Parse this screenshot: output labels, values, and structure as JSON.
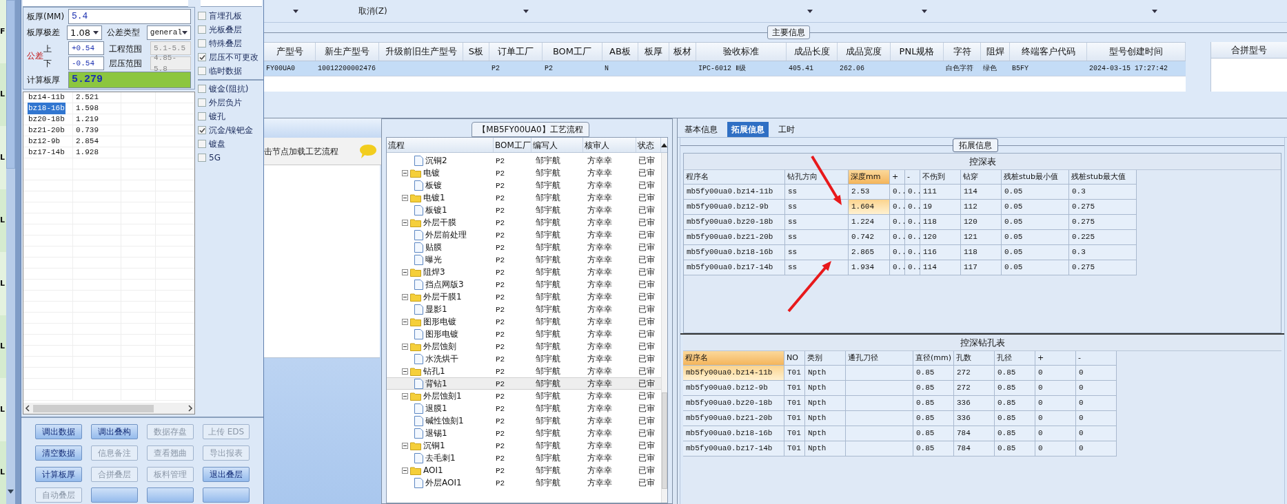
{
  "background_column": [
    "F",
    "L",
    "L",
    "L",
    "L",
    "L",
    "L",
    "L"
  ],
  "board_form": {
    "thickness_label": "板厚(MM)",
    "thickness": "5.4",
    "range_label": "板厚极差",
    "range": "1.08",
    "tol_type_label": "公差类型",
    "tol_type": "general",
    "tol_label": "公差",
    "upper_label": "上",
    "lower_label": "下",
    "upper": "+0.54",
    "lower": "-0.54",
    "eng_range_label": "工程范围",
    "eng_range": "5.1-5.5",
    "lam_range_label": "层压范围",
    "lam_range": "4.85-5.8",
    "calc_label": "计算板厚",
    "calc": "5.279"
  },
  "layer_list": [
    {
      "name": "bz14-11b",
      "value": "2.521",
      "selected": false
    },
    {
      "name": "bz18-16b",
      "value": "1.598",
      "selected": true
    },
    {
      "name": "bz20-18b",
      "value": "1.219",
      "selected": false
    },
    {
      "name": "bz21-20b",
      "value": "0.739",
      "selected": false
    },
    {
      "name": "bz12-9b",
      "value": "2.854",
      "selected": false
    },
    {
      "name": "bz17-14b",
      "value": "1.928",
      "selected": false
    }
  ],
  "option_groups": [
    [
      {
        "label": "盲埋孔板",
        "checked": false
      },
      {
        "label": "光板叠层",
        "checked": false
      },
      {
        "label": "特殊叠层",
        "checked": false
      },
      {
        "label": "层压不可更改",
        "checked": true
      },
      {
        "label": "临时数据",
        "checked": false
      }
    ],
    [
      {
        "label": "镀金(阻抗)",
        "checked": false
      },
      {
        "label": "外层负片",
        "checked": false
      },
      {
        "label": "镀孔",
        "checked": false
      },
      {
        "label": "沉金/镍钯金",
        "checked": true
      },
      {
        "label": "镀盘",
        "checked": false
      },
      {
        "label": "5G",
        "checked": false
      }
    ]
  ],
  "buttons": [
    {
      "label": "调出数据",
      "disabled": false
    },
    {
      "label": "调出叠构",
      "disabled": false
    },
    {
      "label": "数据存盘",
      "disabled": true
    },
    {
      "label": "上传 EDS",
      "disabled": true
    },
    {
      "label": "清空数据",
      "disabled": false
    },
    {
      "label": "信息备注",
      "disabled": true
    },
    {
      "label": "查看翘曲",
      "disabled": true
    },
    {
      "label": "导出报表",
      "disabled": true
    },
    {
      "label": "计算板厚",
      "disabled": false
    },
    {
      "label": "合拼叠层",
      "disabled": true
    },
    {
      "label": "板料管理",
      "disabled": true
    },
    {
      "label": "退出叠层",
      "disabled": false
    },
    {
      "label": "自动叠层",
      "disabled": true
    },
    {
      "disabled": false
    },
    {
      "disabled": false
    },
    {
      "disabled": false
    }
  ],
  "menu": {
    "cancel": "取消(Z)"
  },
  "main_info": {
    "title": "主要信息",
    "columns": [
      "产型号",
      "新生产型号",
      "升级前旧生产型号",
      "S板",
      "订单工厂",
      "BOM工厂",
      "AB板",
      "板厚",
      "板材",
      "验收标准",
      "成品长度",
      "成品宽度",
      "PNL规格",
      "字符",
      "阻焊",
      "终端客户代码",
      "型号创建时间"
    ],
    "rows": [
      {
        "selected": true,
        "cells": [
          "FY00UA0",
          "10012200002476",
          null,
          null,
          "P2",
          "P2",
          "N",
          null,
          null,
          "IPC-6012 Ⅱ级",
          "405.41",
          "262.06",
          null,
          "白色字符",
          "绿色",
          "B5FY",
          "2024-03-15 17:27:42"
        ]
      }
    ],
    "merge_column": "合拼型号"
  },
  "loader_hint": "击节点加载工艺流程",
  "process": {
    "title": "【MB5FY00UA0】工艺流程",
    "columns": [
      "流程",
      "BOM工厂",
      "编写人",
      "核审人",
      "状态"
    ],
    "tree": [
      {
        "children": [
          {
            "label": "沉铜2",
            "bom": "P2",
            "writer": "邹宇航",
            "reviewer": "方幸幸",
            "status": "已审",
            "selected": false
          }
        ]
      },
      {
        "label": "电镀",
        "bom": "P2",
        "writer": "邹宇航",
        "reviewer": "方幸幸",
        "status": "已审",
        "selected": false,
        "expanded": true,
        "children": [
          {
            "label": "板镀",
            "bom": "P2",
            "writer": "邹宇航",
            "reviewer": "方幸幸",
            "status": "已审",
            "selected": false
          }
        ]
      },
      {
        "label": "电镀1",
        "bom": "P2",
        "writer": "邹宇航",
        "reviewer": "方幸幸",
        "status": "已审",
        "selected": false,
        "expanded": true,
        "children": [
          {
            "label": "板镀1",
            "bom": "P2",
            "writer": "邹宇航",
            "reviewer": "方幸幸",
            "status": "已审",
            "selected": false
          }
        ]
      },
      {
        "label": "外层干膜",
        "bom": "P2",
        "writer": "邹宇航",
        "reviewer": "方幸幸",
        "status": "已审",
        "selected": false,
        "expanded": true,
        "children": [
          {
            "label": "外层前处理",
            "bom": "P2",
            "writer": "邹宇航",
            "reviewer": "方幸幸",
            "status": "已审",
            "selected": false
          },
          {
            "label": "贴膜",
            "bom": "P2",
            "writer": "邹宇航",
            "reviewer": "方幸幸",
            "status": "已审",
            "selected": false
          },
          {
            "label": "曝光",
            "bom": "P2",
            "writer": "邹宇航",
            "reviewer": "方幸幸",
            "status": "已审",
            "selected": false
          }
        ]
      },
      {
        "label": "阻焊3",
        "bom": "P2",
        "writer": "邹宇航",
        "reviewer": "方幸幸",
        "status": "已审",
        "selected": false,
        "expanded": true,
        "children": [
          {
            "label": "挡点网版3",
            "bom": "P2",
            "writer": "邹宇航",
            "reviewer": "方幸幸",
            "status": "已审",
            "selected": false
          }
        ]
      },
      {
        "label": "外层干膜1",
        "bom": "P2",
        "writer": "邹宇航",
        "reviewer": "方幸幸",
        "status": "已审",
        "selected": false,
        "expanded": true,
        "children": [
          {
            "label": "显影1",
            "bom": "P2",
            "writer": "邹宇航",
            "reviewer": "方幸幸",
            "status": "已审",
            "selected": false
          }
        ]
      },
      {
        "label": "图形电镀",
        "bom": "P2",
        "writer": "邹宇航",
        "reviewer": "方幸幸",
        "status": "已审",
        "selected": false,
        "expanded": true,
        "children": [
          {
            "label": "图形电镀",
            "bom": "P2",
            "writer": "邹宇航",
            "reviewer": "方幸幸",
            "status": "已审",
            "selected": false
          }
        ]
      },
      {
        "label": "外层蚀刻",
        "bom": "P2",
        "writer": "邹宇航",
        "reviewer": "方幸幸",
        "status": "已审",
        "selected": false,
        "expanded": true,
        "children": [
          {
            "label": "水洗烘干",
            "bom": "P2",
            "writer": "邹宇航",
            "reviewer": "方幸幸",
            "status": "已审",
            "selected": false
          }
        ]
      },
      {
        "label": "钻孔1",
        "bom": "P2",
        "writer": "邹宇航",
        "reviewer": "方幸幸",
        "status": "已审",
        "selected": false,
        "expanded": true,
        "children": [
          {
            "label": "背钻1",
            "bom": "P2",
            "writer": "邹宇航",
            "reviewer": "方幸幸",
            "status": "已审",
            "selected": true
          }
        ]
      },
      {
        "label": "外层蚀刻1",
        "bom": "P2",
        "writer": "邹宇航",
        "reviewer": "方幸幸",
        "status": "已审",
        "selected": false,
        "expanded": true,
        "children": [
          {
            "label": "退膜1",
            "bom": "P2",
            "writer": "邹宇航",
            "reviewer": "方幸幸",
            "status": "已审",
            "selected": false
          },
          {
            "label": "碱性蚀刻1",
            "bom": "P2",
            "writer": "邹宇航",
            "reviewer": "方幸幸",
            "status": "已审",
            "selected": false
          },
          {
            "label": "退锡1",
            "bom": "P2",
            "writer": "邹宇航",
            "reviewer": "方幸幸",
            "status": "已审",
            "selected": false
          }
        ]
      },
      {
        "label": "沉铜1",
        "bom": "P2",
        "writer": "邹宇航",
        "reviewer": "方幸幸",
        "status": "已审",
        "selected": false,
        "expanded": true,
        "children": [
          {
            "label": "去毛刺1",
            "bom": "P2",
            "writer": "邹宇航",
            "reviewer": "方幸幸",
            "status": "已审",
            "selected": false
          }
        ]
      },
      {
        "label": "AOI1",
        "bom": "P2",
        "writer": "邹宇航",
        "reviewer": "方幸幸",
        "status": "已审",
        "selected": false,
        "expanded": true,
        "children": [
          {
            "label": "外层AOI1",
            "bom": "P2",
            "writer": "邹宇航",
            "reviewer": "方幸幸",
            "status": "已审",
            "selected": false
          }
        ]
      }
    ]
  },
  "detail_tabs": [
    {
      "label": "基本信息",
      "selected": false
    },
    {
      "label": "拓展信息",
      "selected": true
    },
    {
      "label": "工时",
      "selected": false
    }
  ],
  "ext_title": "拓展信息",
  "depth_table": {
    "title": "控深表",
    "columns": [
      {
        "label": "程序名",
        "selected": false
      },
      {
        "label": "钻孔方向",
        "selected": false
      },
      {
        "label": "深度mm",
        "selected": true
      },
      {
        "label": "+",
        "selected": false
      },
      {
        "label": "-",
        "selected": false
      },
      {
        "label": "不伤到",
        "selected": false
      },
      {
        "label": "钻穿",
        "selected": false
      },
      {
        "label": "残桩stub最小值",
        "selected": false
      },
      {
        "label": "残桩stub最大值",
        "selected": false
      }
    ],
    "rows": [
      {
        "selected": false,
        "cells": [
          "mb5fy00ua0.bz14-11b",
          "ss",
          "2.53",
          "0..",
          "0..",
          "111",
          "114",
          "0.05",
          "0.3"
        ]
      },
      {
        "selected": true,
        "cells": [
          "mb5fy00ua0.bz12-9b",
          "ss",
          "1.604",
          "0..",
          "0..",
          "19",
          "112",
          "0.05",
          "0.275"
        ]
      },
      {
        "selected": false,
        "cells": [
          "mb5fy00ua0.bz20-18b",
          "ss",
          "1.224",
          "0..",
          "0..",
          "118",
          "120",
          "0.05",
          "0.275"
        ]
      },
      {
        "selected": false,
        "cells": [
          "mb5fy00ua0.bz21-20b",
          "ss",
          "0.742",
          "0..",
          "0..",
          "120",
          "121",
          "0.05",
          "0.225"
        ]
      },
      {
        "selected": false,
        "cells": [
          "mb5fy00ua0.bz18-16b",
          "ss",
          "2.865",
          "0..",
          "0..",
          "116",
          "118",
          "0.05",
          "0.3"
        ]
      },
      {
        "selected": false,
        "cells": [
          "mb5fy00ua0.bz17-14b",
          "ss",
          "1.934",
          "0..",
          "0..",
          "114",
          "117",
          "0.05",
          "0.275"
        ]
      }
    ]
  },
  "drill_table": {
    "title": "控深钻孔表",
    "columns": [
      {
        "label": "程序名",
        "selected": true
      },
      {
        "label": "NO",
        "selected": false
      },
      {
        "label": "类别",
        "selected": false
      },
      {
        "label": "通孔刀径",
        "selected": false
      },
      {
        "label": "直径(mm)",
        "selected": false
      },
      {
        "label": "孔数",
        "selected": false
      },
      {
        "label": "孔径",
        "selected": false
      },
      {
        "label": "+",
        "selected": false
      },
      {
        "label": "-",
        "selected": false
      }
    ],
    "rows": [
      {
        "selected": true,
        "cells": [
          "mb5fy00ua0.bz14-11b",
          "T01",
          "Npth",
          null,
          "0.85",
          "272",
          "0.85",
          "0",
          "0"
        ]
      },
      {
        "selected": false,
        "cells": [
          "mb5fy00ua0.bz12-9b",
          "T01",
          "Npth",
          null,
          "0.85",
          "272",
          "0.85",
          "0",
          "0"
        ]
      },
      {
        "selected": false,
        "cells": [
          "mb5fy00ua0.bz20-18b",
          "T01",
          "Npth",
          null,
          "0.85",
          "336",
          "0.85",
          "0",
          "0"
        ]
      },
      {
        "selected": false,
        "cells": [
          "mb5fy00ua0.bz21-20b",
          "T01",
          "Npth",
          null,
          "0.85",
          "336",
          "0.85",
          "0",
          "0"
        ]
      },
      {
        "selected": false,
        "cells": [
          "mb5fy00ua0.bz18-16b",
          "T01",
          "Npth",
          null,
          "0.85",
          "784",
          "0.85",
          "0",
          "0"
        ]
      },
      {
        "selected": false,
        "cells": [
          "mb5fy00ua0.bz17-14b",
          "T01",
          "Npth",
          null,
          "0.85",
          "784",
          "0.85",
          "0",
          "0"
        ]
      }
    ]
  }
}
